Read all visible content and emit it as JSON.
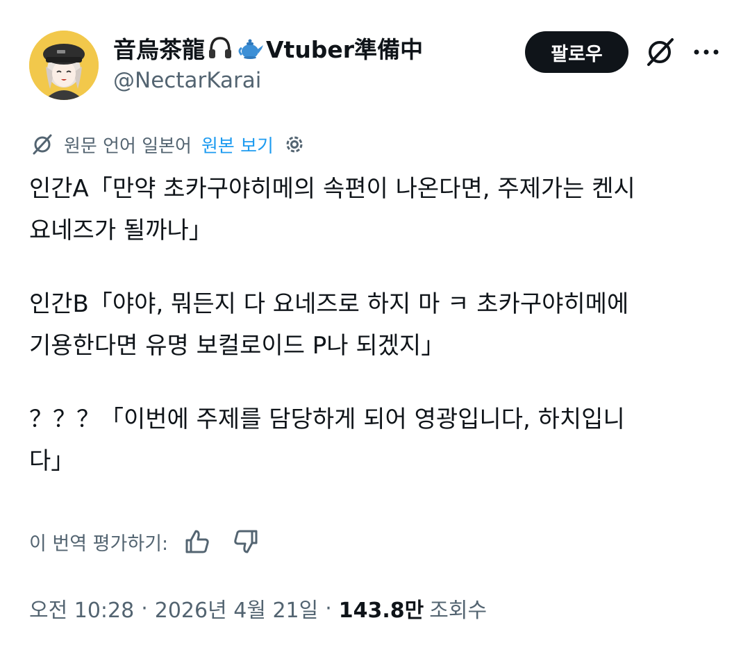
{
  "author": {
    "name_part1": "音烏茶龍",
    "name_part2": "Vtuber準備中",
    "emoji_icons": [
      "headphones-icon",
      "teapot-icon"
    ],
    "handle": "@NectarKarai"
  },
  "follow_button": {
    "label": "팔로우"
  },
  "icons": [
    "grok-icon",
    "more-icon",
    "translate-icon",
    "gear-icon",
    "thumbs-up-icon",
    "thumbs-down-icon"
  ],
  "translation": {
    "notice": "원문 언어 일본어",
    "show_original": "원본 보기"
  },
  "post": {
    "lines": [
      "인간A「만약 초카구야히메의 속편이 나온다면, 주제가는 켄시",
      "요네즈가 될까나」",
      "인간B「야야, 뭐든지 다 요네즈로 하지 마 ㅋ 초카구야히메에",
      "기용한다면 유명 보컬로이드 P나 되겠지」",
      "？？？「이번에 주제를 담당하게 되어 영광입니다, 하치입니",
      "다」"
    ]
  },
  "rating": {
    "label": "이 번역 평가하기:"
  },
  "meta": {
    "time": "오전 10:28",
    "date": "2026년 4월 21일",
    "views_count": "143.8만",
    "views_label": "조회수",
    "separator": "·"
  },
  "colors": {
    "text": "#0f1419",
    "secondary": "#536471",
    "link": "#1d9bf0",
    "button_bg": "#0f1419",
    "avatar_bg": "#f2c84b"
  }
}
